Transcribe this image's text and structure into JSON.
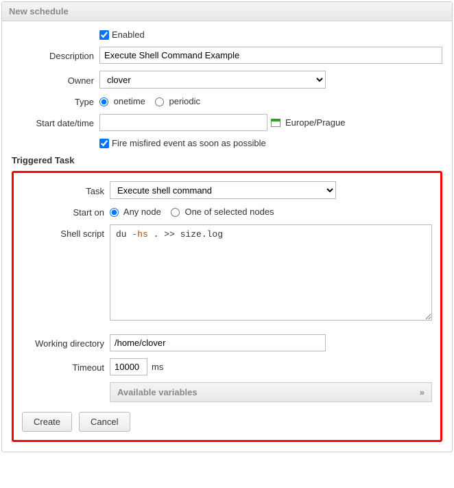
{
  "panel": {
    "title": "New schedule"
  },
  "labels": {
    "enabled": "Enabled",
    "description": "Description",
    "owner": "Owner",
    "type": "Type",
    "startDateTime": "Start date/time",
    "fireMisfired": "Fire misfired event as soon as possible",
    "triggeredTask": "Triggered Task",
    "task": "Task",
    "startOn": "Start on",
    "shellScript": "Shell script",
    "workingDirectory": "Working directory",
    "timeout": "Timeout",
    "timeoutUnit": "ms",
    "availableVariables": "Available variables",
    "availableVariablesChevron": "»"
  },
  "values": {
    "enabled": true,
    "description": "Execute Shell Command Example",
    "owner": "clover",
    "typeOnetime": "onetime",
    "typePeriodic": "periodic",
    "typeSelected": "onetime",
    "startDateTime": "",
    "timezone": "Europe/Prague",
    "fireMisfired": true,
    "task": "Execute shell command",
    "startOnAny": "Any node",
    "startOnSelected": "One of selected nodes",
    "startOnSelectedValue": "any",
    "shellScriptPrefix": "du ",
    "shellScriptFlag": "-hs",
    "shellScriptSuffix": " . >> size.log",
    "workingDirectory": "/home/clover",
    "timeout": "10000"
  },
  "buttons": {
    "create": "Create",
    "cancel": "Cancel"
  }
}
